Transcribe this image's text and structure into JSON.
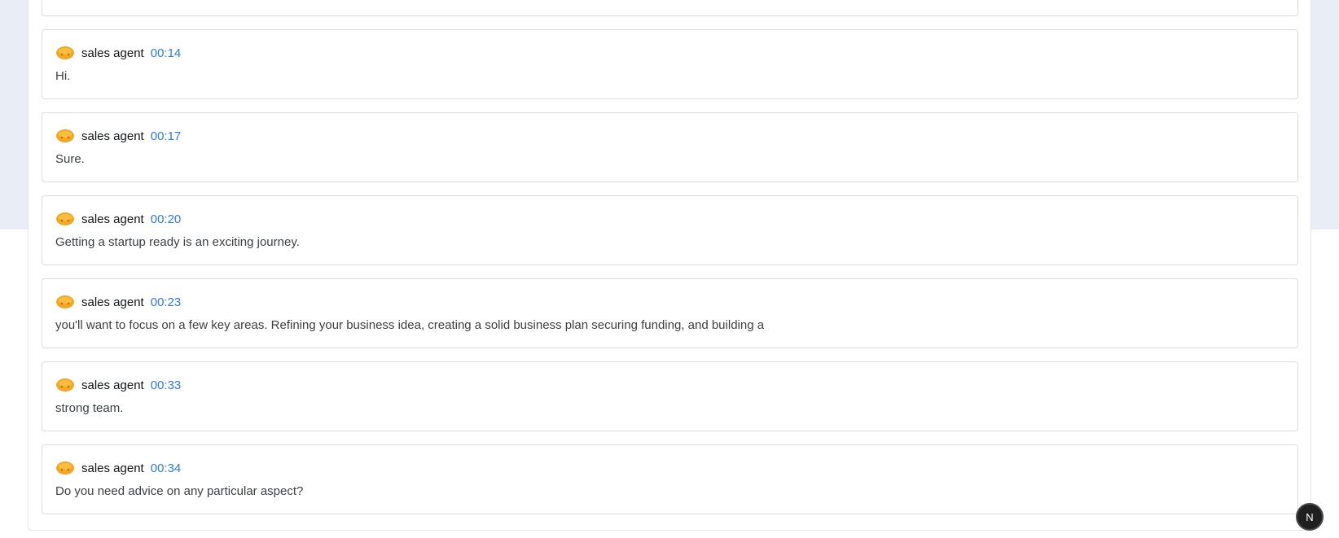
{
  "app": {
    "float_button_label": "N"
  },
  "transcript": {
    "partial_text": "",
    "messages": [
      {
        "sender": "sales agent",
        "time": "00:14",
        "text": "Hi."
      },
      {
        "sender": "sales agent",
        "time": "00:17",
        "text": "Sure."
      },
      {
        "sender": "sales agent",
        "time": "00:20",
        "text": "Getting a startup ready is an exciting journey."
      },
      {
        "sender": "sales agent",
        "time": "00:23",
        "text": "you'll want to focus on a few key areas. Refining your business idea, creating a solid business plan securing funding, and building a"
      },
      {
        "sender": "sales agent",
        "time": "00:33",
        "text": "strong team."
      },
      {
        "sender": "sales agent",
        "time": "00:34",
        "text": "Do you need advice on any particular aspect?"
      }
    ]
  },
  "colors": {
    "time_accent": "#2f7ae5",
    "avatar": "#f5a623",
    "top_band": "#e9edf6"
  },
  "icons": {
    "avatar": "orange-blob-avatar-icon"
  }
}
